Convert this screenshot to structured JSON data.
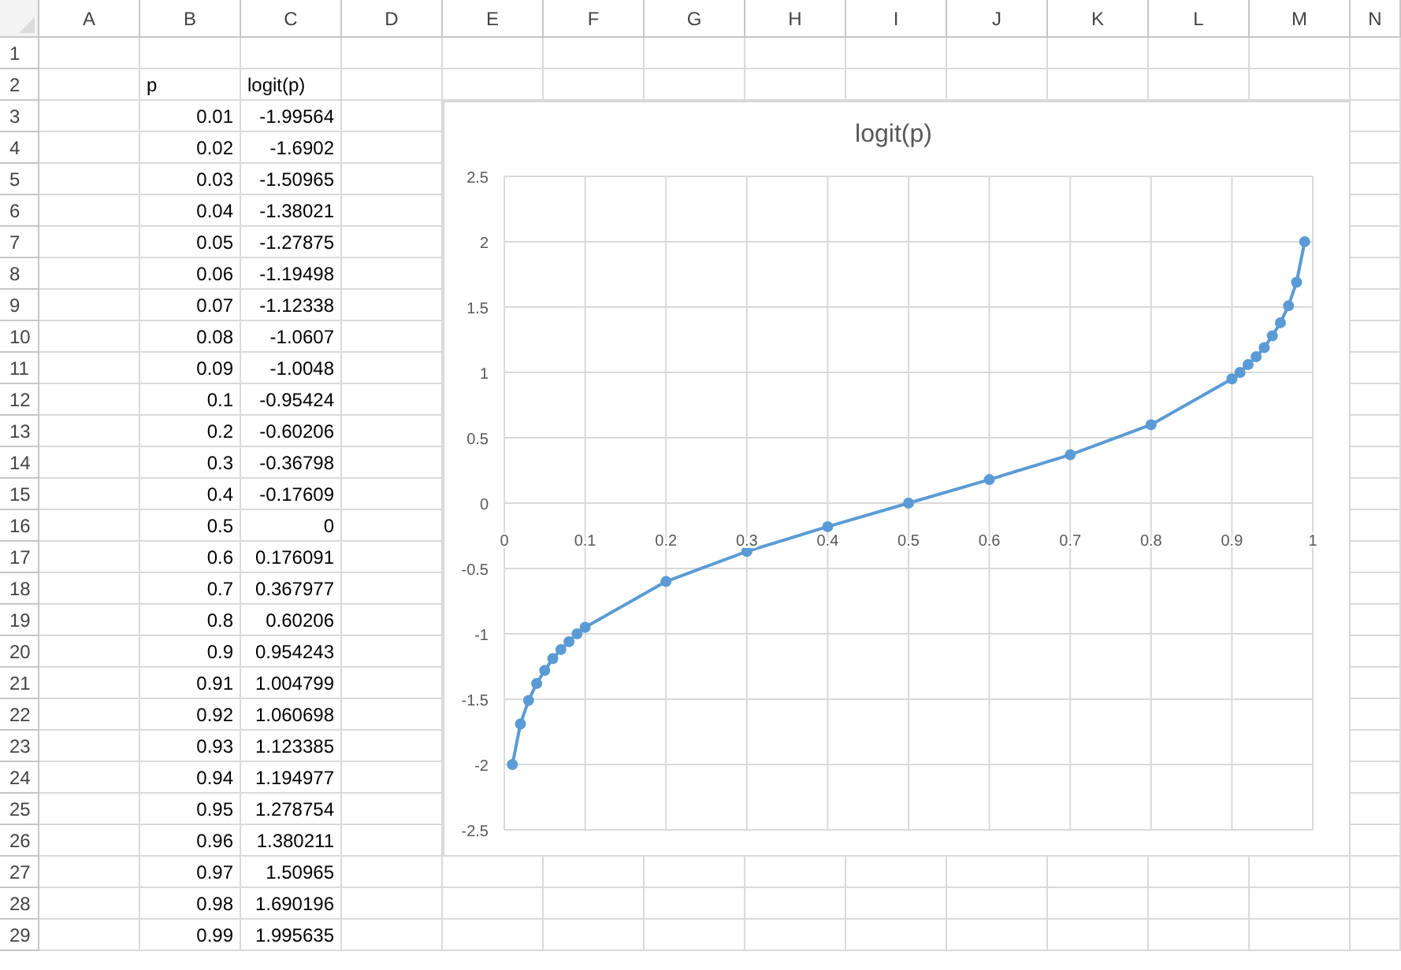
{
  "sheet": {
    "columns": [
      "A",
      "B",
      "C",
      "D",
      "E",
      "F",
      "G",
      "H",
      "I",
      "J",
      "K",
      "L",
      "M",
      "N"
    ],
    "rows": [
      {
        "number": "1",
        "kind": "empty"
      },
      {
        "number": "2",
        "kind": "header",
        "b": "p",
        "c": "logit(p)"
      },
      {
        "number": "3",
        "kind": "data",
        "b": "0.01",
        "c": "-1.99564"
      },
      {
        "number": "4",
        "kind": "data",
        "b": "0.02",
        "c": "-1.6902"
      },
      {
        "number": "5",
        "kind": "data",
        "b": "0.03",
        "c": "-1.50965"
      },
      {
        "number": "6",
        "kind": "data",
        "b": "0.04",
        "c": "-1.38021"
      },
      {
        "number": "7",
        "kind": "data",
        "b": "0.05",
        "c": "-1.27875"
      },
      {
        "number": "8",
        "kind": "data",
        "b": "0.06",
        "c": "-1.19498"
      },
      {
        "number": "9",
        "kind": "data",
        "b": "0.07",
        "c": "-1.12338"
      },
      {
        "number": "10",
        "kind": "data",
        "b": "0.08",
        "c": "-1.0607"
      },
      {
        "number": "11",
        "kind": "data",
        "b": "0.09",
        "c": "-1.0048"
      },
      {
        "number": "12",
        "kind": "data",
        "b": "0.1",
        "c": "-0.95424"
      },
      {
        "number": "13",
        "kind": "data",
        "b": "0.2",
        "c": "-0.60206"
      },
      {
        "number": "14",
        "kind": "data",
        "b": "0.3",
        "c": "-0.36798"
      },
      {
        "number": "15",
        "kind": "data",
        "b": "0.4",
        "c": "-0.17609"
      },
      {
        "number": "16",
        "kind": "data",
        "b": "0.5",
        "c": "0"
      },
      {
        "number": "17",
        "kind": "data",
        "b": "0.6",
        "c": "0.176091"
      },
      {
        "number": "18",
        "kind": "data",
        "b": "0.7",
        "c": "0.367977"
      },
      {
        "number": "19",
        "kind": "data",
        "b": "0.8",
        "c": "0.60206"
      },
      {
        "number": "20",
        "kind": "data",
        "b": "0.9",
        "c": "0.954243"
      },
      {
        "number": "21",
        "kind": "data",
        "b": "0.91",
        "c": "1.004799"
      },
      {
        "number": "22",
        "kind": "data",
        "b": "0.92",
        "c": "1.060698"
      },
      {
        "number": "23",
        "kind": "data",
        "b": "0.93",
        "c": "1.123385"
      },
      {
        "number": "24",
        "kind": "data",
        "b": "0.94",
        "c": "1.194977"
      },
      {
        "number": "25",
        "kind": "data",
        "b": "0.95",
        "c": "1.278754"
      },
      {
        "number": "26",
        "kind": "data",
        "b": "0.96",
        "c": "1.380211"
      },
      {
        "number": "27",
        "kind": "data",
        "b": "0.97",
        "c": "1.50965"
      },
      {
        "number": "28",
        "kind": "data",
        "b": "0.98",
        "c": "1.690196"
      },
      {
        "number": "29",
        "kind": "data",
        "b": "0.99",
        "c": "1.995635"
      }
    ]
  },
  "chart": {
    "chart_data": {
      "type": "line",
      "grid": true,
      "x": [
        0.01,
        0.02,
        0.03,
        0.04,
        0.05,
        0.06,
        0.07,
        0.08,
        0.09,
        0.1,
        0.2,
        0.3,
        0.4,
        0.5,
        0.6,
        0.7,
        0.8,
        0.9,
        0.91,
        0.92,
        0.93,
        0.94,
        0.95,
        0.96,
        0.97,
        0.98,
        0.99
      ],
      "series": [
        {
          "name": "logit(p)",
          "color": "#5b9bd5",
          "marker": "circle",
          "values": [
            -2,
            -1.69,
            -1.51,
            -1.38,
            -1.28,
            -1.19,
            -1.12,
            -1.06,
            -1,
            -0.95,
            -0.6,
            -0.37,
            -0.18,
            0,
            0.18,
            0.37,
            0.6,
            0.95,
            1,
            1.06,
            1.12,
            1.19,
            1.28,
            1.38,
            1.51,
            1.69,
            2
          ]
        }
      ],
      "xlim": [
        0,
        1
      ],
      "ylim": [
        -2.5,
        2.5
      ],
      "xticks": [
        0,
        0.1,
        0.2,
        0.3,
        0.4,
        0.5,
        0.6,
        0.7,
        0.8,
        0.9,
        1
      ],
      "yticks": [
        -2.5,
        -2,
        -1.5,
        -1,
        -0.5,
        0,
        0.5,
        1,
        1.5,
        2,
        2.5
      ]
    }
  }
}
